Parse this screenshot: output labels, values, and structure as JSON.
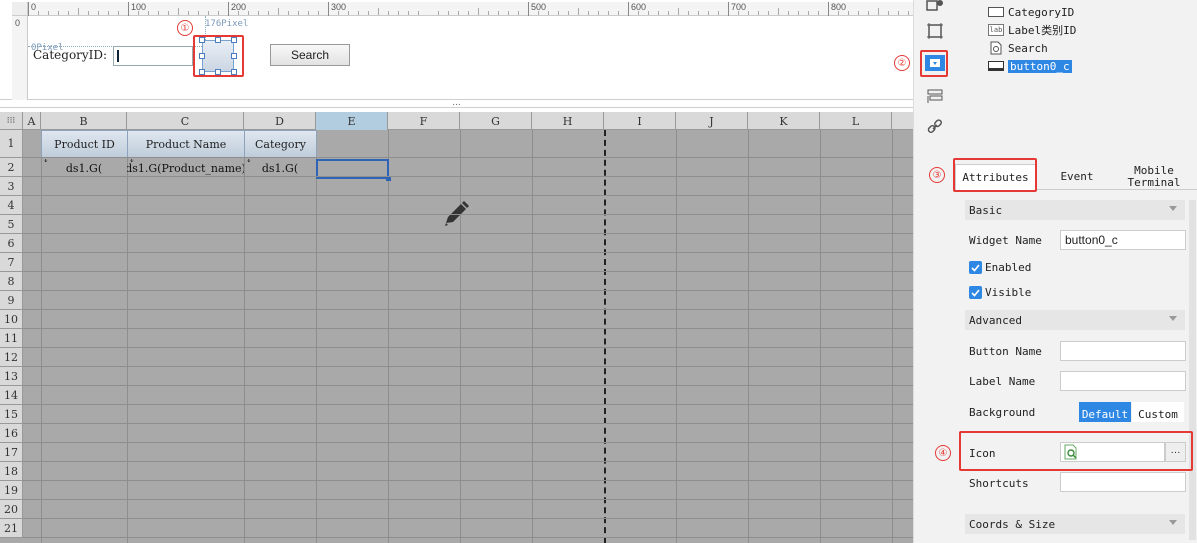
{
  "designer": {
    "ruler_ticks": [
      "0",
      "100",
      "200",
      "300",
      "400",
      "500",
      "600",
      "700",
      "800"
    ],
    "vruler_label": "0",
    "width_label": "176Pixel",
    "height_label": "0Pixel",
    "category_label": "CategoryID:",
    "search_button": "Search"
  },
  "annotations": [
    "①",
    "②",
    "③",
    "④"
  ],
  "splitter_grip": "...",
  "sheet": {
    "columns": [
      "A",
      "B",
      "C",
      "D",
      "E",
      "F",
      "G",
      "H",
      "I",
      "J",
      "K",
      "L"
    ],
    "selected_column": "E",
    "rows": [
      "1",
      "2",
      "3",
      "4",
      "5",
      "6",
      "7",
      "8",
      "9",
      "10",
      "11",
      "12",
      "13",
      "14",
      "15",
      "16",
      "17",
      "18",
      "19",
      "20",
      "21"
    ],
    "header_cells": [
      "Product ID",
      "Product Name",
      "Category"
    ],
    "data_cells": [
      "ds1.G(",
      "ds1.G(Product_name)",
      "ds1.G("
    ],
    "expand_arrow": "↓"
  },
  "widget_tree": [
    {
      "label": "CategoryID",
      "icon": "textbox-icon"
    },
    {
      "label": "Label类别ID",
      "icon": "label-icon",
      "icon_text": "lab"
    },
    {
      "label": "Search",
      "icon": "search-button-icon"
    },
    {
      "label": "button0_c",
      "icon": "button-icon",
      "selected": true
    }
  ],
  "tabs": {
    "attributes": "Attributes",
    "event": "Event",
    "mobile_line1": "Mobile",
    "mobile_line2": "Terminal"
  },
  "properties": {
    "basic": "Basic",
    "widget_name_label": "Widget Name",
    "widget_name_value": "button0_c",
    "enabled": "Enabled",
    "visible": "Visible",
    "advanced": "Advanced",
    "button_name": "Button Name",
    "label_name": "Label Name",
    "background": "Background",
    "bg_default": "Default",
    "bg_custom": "Custom",
    "icon": "Icon",
    "icon_more": "···",
    "shortcuts": "Shortcuts",
    "coords_size": "Coords & Size"
  },
  "colors": {
    "accent_blue": "#2f87e4",
    "annotation_red": "#e53935",
    "sheet_gray": "#a9a9a9"
  }
}
